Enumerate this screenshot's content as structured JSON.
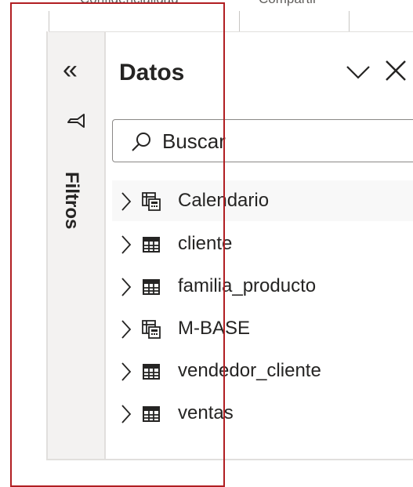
{
  "ribbon": {
    "tabs": [
      "Confidencialidad",
      "Compartir"
    ]
  },
  "filters": {
    "collapse_glyph": "«",
    "label": "Filtros"
  },
  "data_pane": {
    "title": "Datos",
    "close_glyph": "✕",
    "search": {
      "text": "Buscar"
    },
    "tables": [
      {
        "label": "Calendario",
        "icon": "calculated-table-icon"
      },
      {
        "label": "cliente",
        "icon": "table-icon"
      },
      {
        "label": "familia_producto",
        "icon": "table-icon"
      },
      {
        "label": "M-BASE",
        "icon": "calculated-table-icon"
      },
      {
        "label": "vendedor_cliente",
        "icon": "table-icon"
      },
      {
        "label": "ventas",
        "icon": "table-icon"
      }
    ]
  },
  "colors": {
    "annotation": "#b11e22",
    "filters_pane_bg": "#f3f2f1",
    "text": "#252423"
  }
}
